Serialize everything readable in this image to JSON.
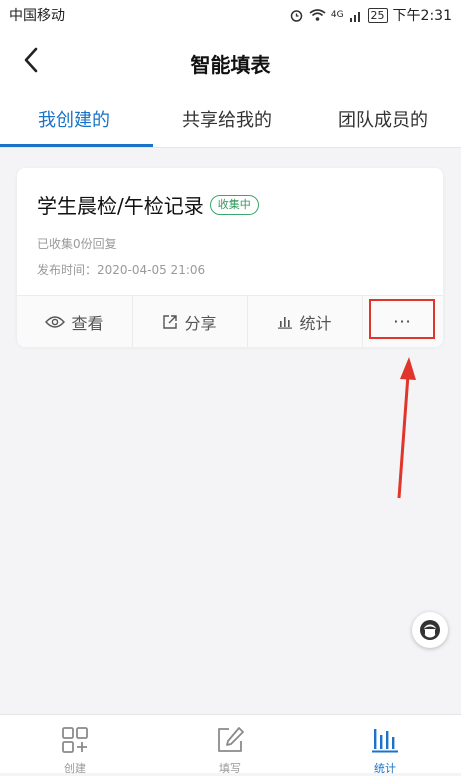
{
  "status_bar": {
    "carrier": "中国移动",
    "signal_label": "4G",
    "battery": "25",
    "time": "下午2:31"
  },
  "nav": {
    "title": "智能填表"
  },
  "tabs": [
    {
      "label": "我创建的",
      "active": true
    },
    {
      "label": "共享给我的",
      "active": false
    },
    {
      "label": "团队成员的",
      "active": false
    }
  ],
  "form_card": {
    "title": "学生晨检/午检记录",
    "status_badge": "收集中",
    "responses": "已收集0份回复",
    "publish_time": "发布时间：2020-04-05 21:06",
    "actions": [
      {
        "label": "查看",
        "icon": "eye-icon"
      },
      {
        "label": "分享",
        "icon": "share-icon"
      },
      {
        "label": "统计",
        "icon": "bar-chart-icon"
      },
      {
        "label": "···",
        "icon": "more-icon"
      }
    ]
  },
  "bottom_nav": [
    {
      "label": "创建",
      "icon": "create-grid-icon",
      "active": false
    },
    {
      "label": "填写",
      "icon": "edit-icon",
      "active": false
    },
    {
      "label": "统计",
      "icon": "stats-icon",
      "active": true
    }
  ],
  "colors": {
    "accent": "#1a73c8",
    "badge": "#2f9a5e",
    "highlight": "#e0352b"
  }
}
